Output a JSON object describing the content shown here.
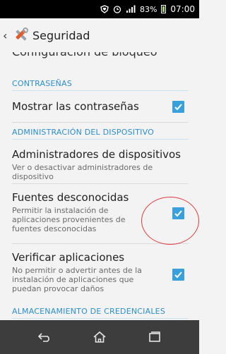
{
  "status_bar": {
    "battery_percent": "83%",
    "time": "07:00",
    "icons": [
      "shield-heart-icon",
      "alarm-icon",
      "signal-icon",
      "battery-icon"
    ]
  },
  "action_bar": {
    "title": "Seguridad",
    "icons": [
      "back-chevron-icon",
      "settings-tools-icon"
    ]
  },
  "list": {
    "partial_item": "Configuración de bloqueo",
    "sections": [
      {
        "header": "CONTRASEÑAS",
        "items": [
          {
            "title": "Mostrar las contraseñas",
            "checked": true
          }
        ]
      },
      {
        "header": "ADMINISTRACIÓN DEL DISPOSITIVO",
        "items": [
          {
            "title": "Administradores de dispositivos",
            "subtitle": "Ver o desactivar administradores de dispositivo"
          },
          {
            "title": "Fuentes desconocidas",
            "subtitle": "Permitir la instalación de aplicaciones provenientes de fuentes desconocidas",
            "checked": true
          },
          {
            "title": "Verificar aplicaciones",
            "subtitle": "No permitir o advertir antes de la instalación de aplicaciones que puedan provocar daños",
            "checked": true
          }
        ]
      },
      {
        "header": "ALMACENAMIENTO DE CREDENCIALES",
        "items": []
      }
    ]
  },
  "colors": {
    "accent": "#3aa0dc",
    "section_header": "#2a8fcc",
    "annotation": "#e2393f",
    "navbar": "#3d3d3d"
  },
  "nav_bar": {
    "icons": [
      "back-icon",
      "home-icon",
      "recent-apps-icon"
    ]
  }
}
